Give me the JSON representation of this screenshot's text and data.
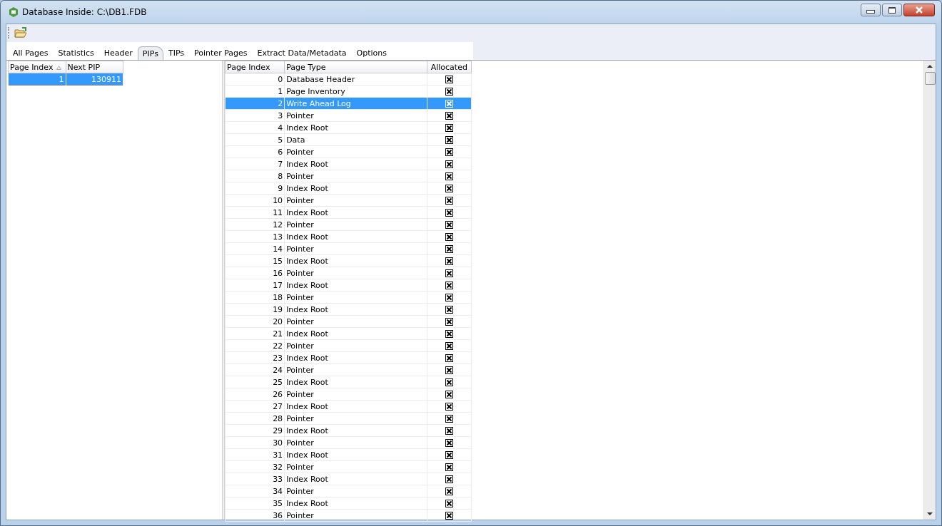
{
  "window": {
    "title": "Database Inside: C:\\DB1.FDB"
  },
  "tabs": [
    {
      "label": "All Pages",
      "selected": false
    },
    {
      "label": "Statistics",
      "selected": false
    },
    {
      "label": "Header",
      "selected": false
    },
    {
      "label": "PIPs",
      "selected": true
    },
    {
      "label": "TIPs",
      "selected": false
    },
    {
      "label": "Pointer Pages",
      "selected": false
    },
    {
      "label": "Extract Data/Metadata",
      "selected": false
    },
    {
      "label": "Options",
      "selected": false
    }
  ],
  "pip_table": {
    "columns": [
      {
        "label": "Page Index",
        "sorted": true
      },
      {
        "label": "Next PIP",
        "sorted": false
      }
    ],
    "rows": [
      {
        "cells": [
          "1",
          "130911"
        ],
        "selected": true
      }
    ]
  },
  "page_table": {
    "columns": [
      "Page Index",
      "Page Type",
      "Allocated"
    ],
    "rows": [
      {
        "index": "0",
        "type": "Database Header",
        "allocated": true,
        "selected": false
      },
      {
        "index": "1",
        "type": "Page Inventory",
        "allocated": true,
        "selected": false
      },
      {
        "index": "2",
        "type": "Write Ahead Log",
        "allocated": true,
        "selected": true
      },
      {
        "index": "3",
        "type": "Pointer",
        "allocated": true,
        "selected": false
      },
      {
        "index": "4",
        "type": "Index Root",
        "allocated": true,
        "selected": false
      },
      {
        "index": "5",
        "type": "Data",
        "allocated": true,
        "selected": false
      },
      {
        "index": "6",
        "type": "Pointer",
        "allocated": true,
        "selected": false
      },
      {
        "index": "7",
        "type": "Index Root",
        "allocated": true,
        "selected": false
      },
      {
        "index": "8",
        "type": "Pointer",
        "allocated": true,
        "selected": false
      },
      {
        "index": "9",
        "type": "Index Root",
        "allocated": true,
        "selected": false
      },
      {
        "index": "10",
        "type": "Pointer",
        "allocated": true,
        "selected": false
      },
      {
        "index": "11",
        "type": "Index Root",
        "allocated": true,
        "selected": false
      },
      {
        "index": "12",
        "type": "Pointer",
        "allocated": true,
        "selected": false
      },
      {
        "index": "13",
        "type": "Index Root",
        "allocated": true,
        "selected": false
      },
      {
        "index": "14",
        "type": "Pointer",
        "allocated": true,
        "selected": false
      },
      {
        "index": "15",
        "type": "Index Root",
        "allocated": true,
        "selected": false
      },
      {
        "index": "16",
        "type": "Pointer",
        "allocated": true,
        "selected": false
      },
      {
        "index": "17",
        "type": "Index Root",
        "allocated": true,
        "selected": false
      },
      {
        "index": "18",
        "type": "Pointer",
        "allocated": true,
        "selected": false
      },
      {
        "index": "19",
        "type": "Index Root",
        "allocated": true,
        "selected": false
      },
      {
        "index": "20",
        "type": "Pointer",
        "allocated": true,
        "selected": false
      },
      {
        "index": "21",
        "type": "Index Root",
        "allocated": true,
        "selected": false
      },
      {
        "index": "22",
        "type": "Pointer",
        "allocated": true,
        "selected": false
      },
      {
        "index": "23",
        "type": "Index Root",
        "allocated": true,
        "selected": false
      },
      {
        "index": "24",
        "type": "Pointer",
        "allocated": true,
        "selected": false
      },
      {
        "index": "25",
        "type": "Index Root",
        "allocated": true,
        "selected": false
      },
      {
        "index": "26",
        "type": "Pointer",
        "allocated": true,
        "selected": false
      },
      {
        "index": "27",
        "type": "Index Root",
        "allocated": true,
        "selected": false
      },
      {
        "index": "28",
        "type": "Pointer",
        "allocated": true,
        "selected": false
      },
      {
        "index": "29",
        "type": "Index Root",
        "allocated": true,
        "selected": false
      },
      {
        "index": "30",
        "type": "Pointer",
        "allocated": true,
        "selected": false
      },
      {
        "index": "31",
        "type": "Index Root",
        "allocated": true,
        "selected": false
      },
      {
        "index": "32",
        "type": "Pointer",
        "allocated": true,
        "selected": false
      },
      {
        "index": "33",
        "type": "Index Root",
        "allocated": true,
        "selected": false
      },
      {
        "index": "34",
        "type": "Pointer",
        "allocated": true,
        "selected": false
      },
      {
        "index": "35",
        "type": "Index Root",
        "allocated": true,
        "selected": false
      },
      {
        "index": "36",
        "type": "Pointer",
        "allocated": true,
        "selected": false
      }
    ]
  }
}
